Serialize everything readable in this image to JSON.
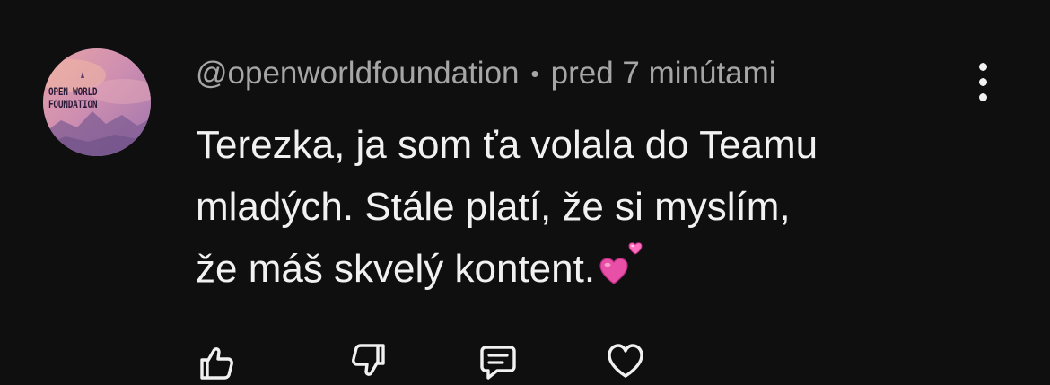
{
  "comment": {
    "author": "@openworldfoundation",
    "separator": "•",
    "timestamp": "pred 7 minútami",
    "avatar_text_line1": "OPEN WORLD",
    "avatar_text_line2": "FOUNDATION",
    "text": "Terezka, ja som ťa volala do Teamu\nmladých. Stále platí, že si myslím,\nže máš skvelý kontent.",
    "emoji": "two-hearts-emoji"
  },
  "actions": {
    "like_icon": "thumbs-up-icon",
    "dislike_icon": "thumbs-down-icon",
    "reply_icon": "reply-comment-icon",
    "heart_icon": "heart-icon"
  },
  "menu": {
    "icon": "more-vertical-icon"
  },
  "colors": {
    "background": "#0f0f0f",
    "meta_text": "#a6a6a6",
    "body_text": "#f1f1f1",
    "emoji_pink": "#e84fa6"
  }
}
